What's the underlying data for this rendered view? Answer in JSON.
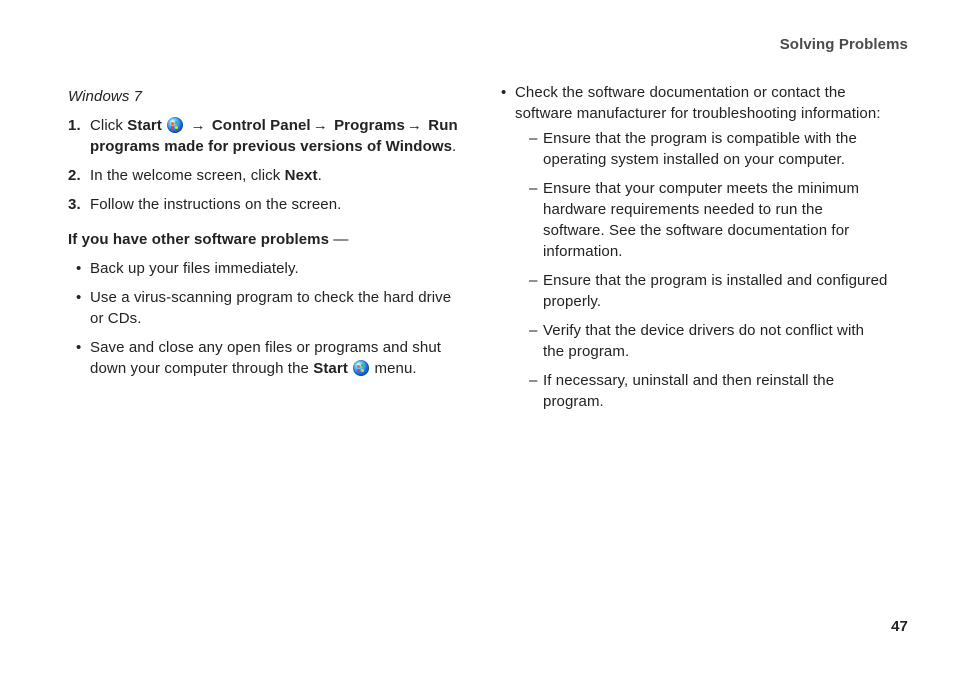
{
  "header": "Solving Problems",
  "page_number": "47",
  "left": {
    "subhead": "Windows 7",
    "s1": {
      "a": "Click ",
      "b": "Start",
      "c": " ",
      "d": " → ",
      "e": "Control Panel",
      "f": "→ ",
      "g": "Programs",
      "h": "→ ",
      "i": "Run programs made for previous versions of Windows",
      "j": "."
    },
    "s2": {
      "a": "In the welcome screen, click ",
      "b": "Next",
      "c": "."
    },
    "s3": "Follow the instructions on the screen.",
    "problems_label": "If you have other software problems",
    "problems_dash": " —",
    "b1": "Back up your files immediately.",
    "b2": "Use a virus-scanning program to check the hard drive or CDs.",
    "b3": {
      "a": "Save and close any open files or programs and shut down your computer through the ",
      "b": "Start",
      "c": " ",
      "d": " menu."
    }
  },
  "right": {
    "b4": "Check the software documentation or contact the software manufacturer for troubleshooting information:",
    "d1": "Ensure that the program is compatible with the operating system installed on your computer.",
    "d2": "Ensure that your computer meets the minimum hardware requirements needed to run the software. See the software documentation for information.",
    "d3": "Ensure that the program is installed and configured properly.",
    "d4": "Verify that the device drivers do not conflict with the program.",
    "d5": "If necessary, uninstall and then reinstall the program."
  }
}
